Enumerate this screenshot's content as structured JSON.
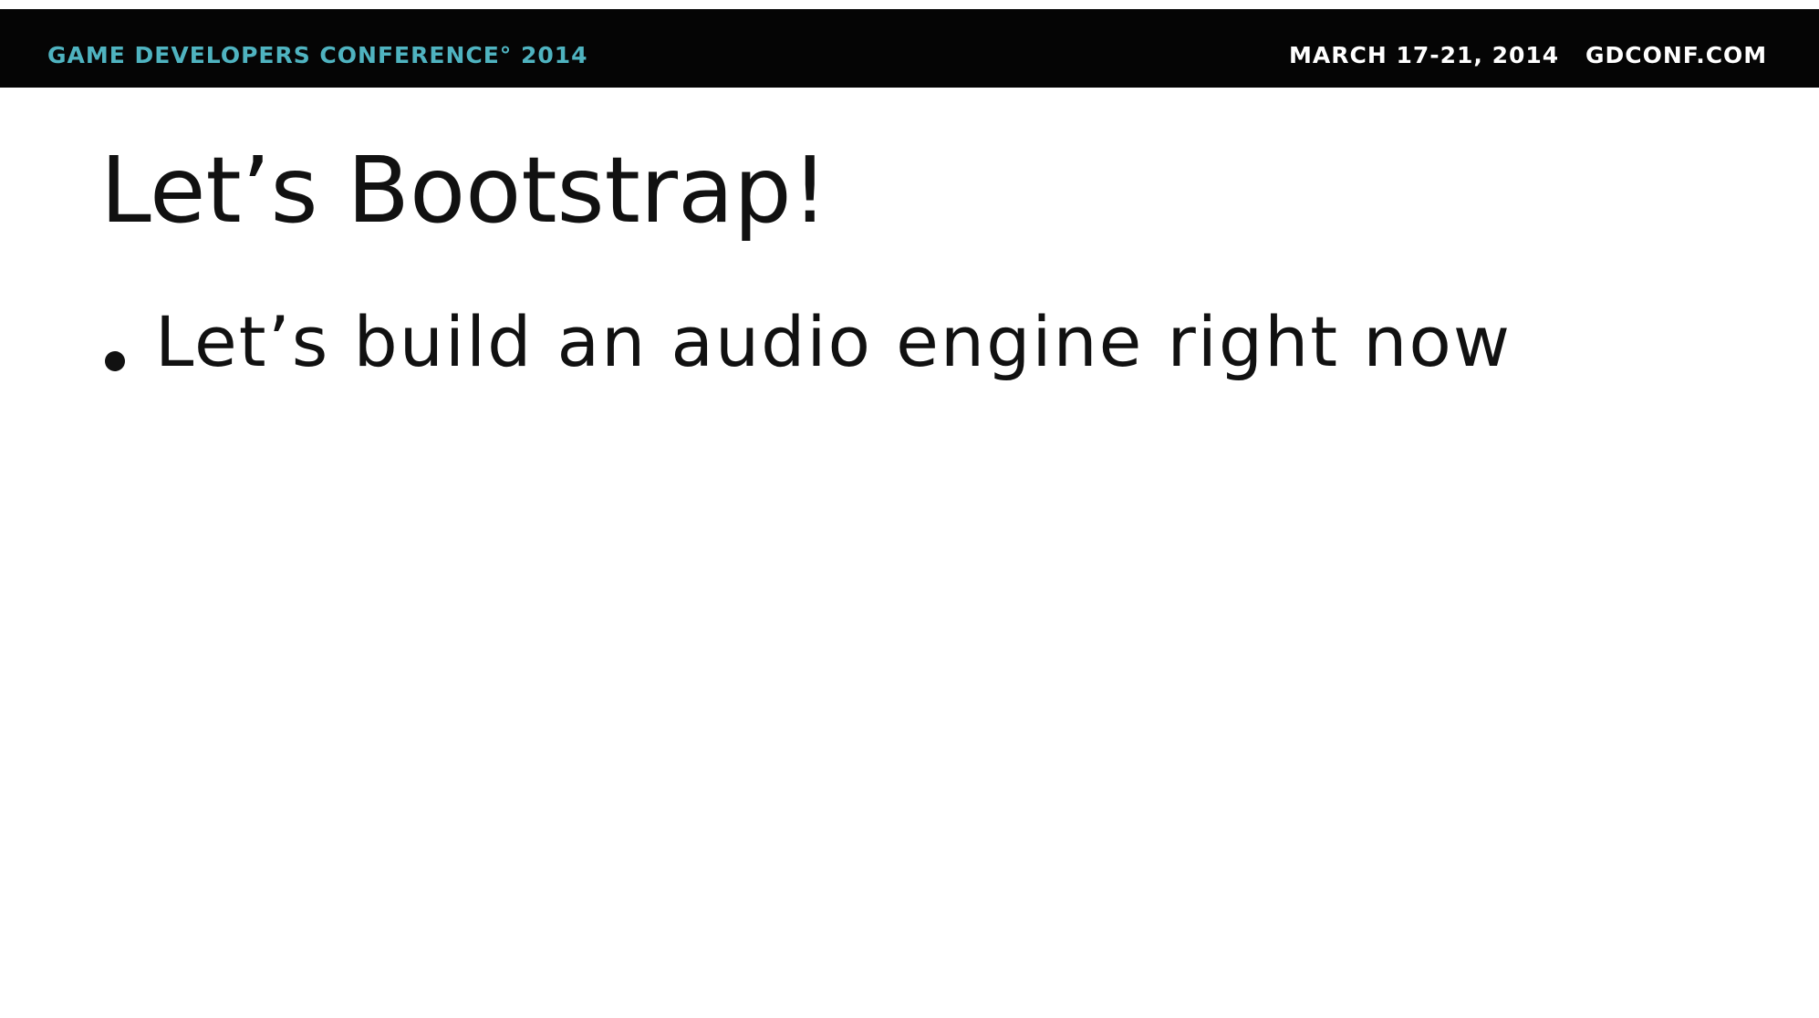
{
  "header": {
    "conference_name": "GAME DEVELOPERS CONFERENCE° 2014",
    "dates": "MARCH 17-21, 2014",
    "url": "GDCONF.COM"
  },
  "slide": {
    "title": "Let’s Bootstrap!",
    "bullets": [
      {
        "text": "Let’s build an audio engine right now"
      }
    ]
  },
  "colors": {
    "header_background": "#050505",
    "conference_name": "#4fb3c0",
    "header_text": "#ffffff",
    "body_text": "#111111",
    "slide_background": "#ffffff"
  }
}
